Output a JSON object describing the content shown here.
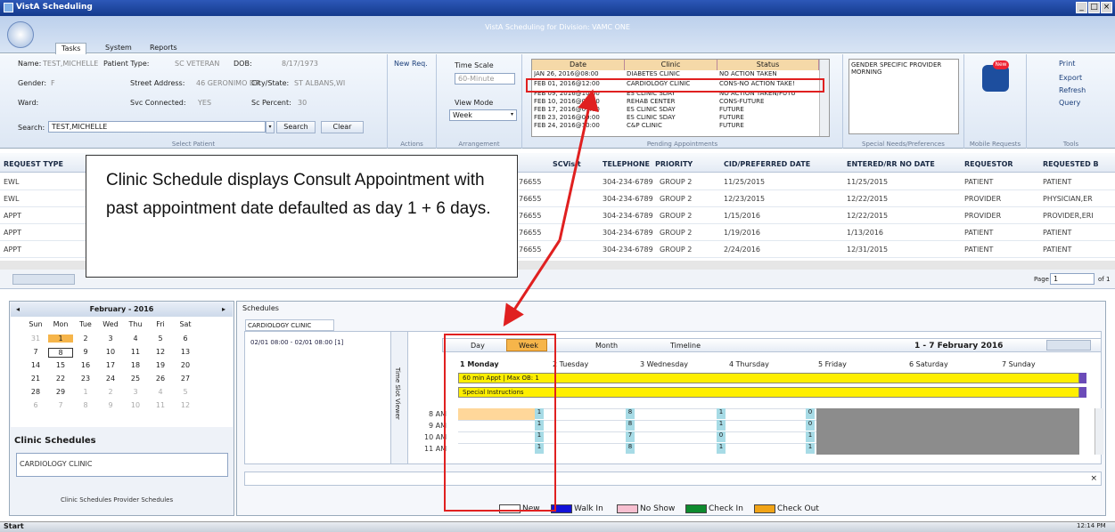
{
  "window": {
    "title": "VistA Scheduling",
    "app_title": "VistA Scheduling for Division: VAMC ONE",
    "controls": [
      "_",
      "□",
      "×"
    ]
  },
  "tabs": [
    "Tasks",
    "System",
    "Reports"
  ],
  "patient": {
    "name_label": "Name:",
    "name": "TEST,MICHELLE",
    "type_label": "Patient Type:",
    "type": "SC VETERAN",
    "dob_label": "DOB:",
    "dob": "8/17/1973",
    "gender_label": "Gender:",
    "gender": "F",
    "street_label": "Street Address:",
    "street": "46 GERONIMO DR",
    "city_label": "City/State:",
    "city": "ST ALBANS,WI",
    "ward_label": "Ward:",
    "svc_label": "Svc Connected:",
    "svc": "YES",
    "scpct_label": "Sc Percent:",
    "scpct": "30",
    "search_label": "Search:",
    "search_value": "TEST,MICHELLE",
    "search_btn": "Search",
    "clear_btn": "Clear",
    "group": "Select Patient"
  },
  "actions": {
    "new_req": "New Req.",
    "group": "Actions"
  },
  "arrangement": {
    "time_scale_label": "Time Scale",
    "time_scale": "60-Minute",
    "view_mode_label": "View Mode",
    "view_mode": "Week",
    "group": "Arrangement"
  },
  "pending": {
    "headers": [
      "Date",
      "Clinic",
      "Status"
    ],
    "group": "Pending Appointments",
    "rows": [
      [
        "JAN 26, 2016@08:00",
        "DIABETES CLINIC",
        "NO ACTION TAKEN"
      ],
      [
        "FEB 01, 2016@12:00",
        "CARDIOLOGY CLINIC",
        "CONS-NO ACTION TAKE!"
      ],
      [
        "FEB 09, 2016@10:00",
        "ES CLINIC SDAY",
        "NO ACTION TAKEN/FUTU"
      ],
      [
        "FEB 10, 2016@09:00",
        "REHAB CENTER",
        "CONS-FUTURE"
      ],
      [
        "FEB 17, 2016@09:00",
        "ES CLINIC SDAY",
        "FUTURE"
      ],
      [
        "FEB 23, 2016@09:00",
        "ES CLINIC SDAY",
        "FUTURE"
      ],
      [
        "FEB 24, 2016@10:00",
        "C&P CLINIC",
        "FUTURE"
      ]
    ]
  },
  "special": {
    "text": "GENDER SPECIFIC PROVIDER MORNING",
    "group": "Special Needs/Preferences"
  },
  "mobile": {
    "badge": "New",
    "group": "Mobile Requests"
  },
  "tools": {
    "items": [
      "Print",
      "Export",
      "Refresh",
      "Query"
    ],
    "group": "Tools"
  },
  "grid": {
    "headers": [
      "REQUEST TYPE",
      "SCVisit",
      "TELEPHONE",
      "PRIORITY",
      "CID/PREFERRED DATE",
      "ENTERED/RR NO DATE",
      "REQUESTOR",
      "REQUESTED B"
    ],
    "rows": [
      [
        "EWL",
        "76655",
        "304-234-6789",
        "GROUP 2",
        "11/25/2015",
        "11/25/2015",
        "PATIENT",
        "PATIENT"
      ],
      [
        "EWL",
        "76655",
        "304-234-6789",
        "GROUP 2",
        "12/23/2015",
        "12/22/2015",
        "PROVIDER",
        "PHYSICIAN,ER"
      ],
      [
        "APPT",
        "76655",
        "304-234-6789",
        "GROUP 2",
        "1/15/2016",
        "12/22/2015",
        "PROVIDER",
        "PROVIDER,ERI"
      ],
      [
        "APPT",
        "76655",
        "304-234-6789",
        "GROUP 2",
        "1/19/2016",
        "1/13/2016",
        "PATIENT",
        "PATIENT"
      ],
      [
        "APPT",
        "76655",
        "304-234-6789",
        "GROUP 2",
        "2/24/2016",
        "12/31/2015",
        "PATIENT",
        "PATIENT"
      ]
    ],
    "page_label": "Page",
    "page": "1",
    "of": "of 1"
  },
  "callout": "Clinic Schedule displays Consult Appointment with past appointment date defaulted as day 1 + 6 days.",
  "calendar": {
    "month": "February - 2016",
    "days": [
      "Sun",
      "Mon",
      "Tue",
      "Wed",
      "Thu",
      "Fri",
      "Sat"
    ],
    "weeks": [
      [
        "31",
        "1",
        "2",
        "3",
        "4",
        "5",
        "6"
      ],
      [
        "7",
        "8",
        "9",
        "10",
        "11",
        "12",
        "13"
      ],
      [
        "14",
        "15",
        "16",
        "17",
        "18",
        "19",
        "20"
      ],
      [
        "21",
        "22",
        "23",
        "24",
        "25",
        "26",
        "27"
      ],
      [
        "28",
        "29",
        "1",
        "2",
        "3",
        "4",
        "5"
      ],
      [
        "6",
        "7",
        "8",
        "9",
        "10",
        "11",
        "12"
      ]
    ]
  },
  "clinic_schedules": {
    "title": "Clinic Schedules",
    "item": "CARDIOLOGY CLINIC",
    "tabs": "Clinic Schedules  Provider Schedules"
  },
  "schedule": {
    "pane_title": "Schedules",
    "clinic_tab": "CARDIOLOGY CLINIC",
    "slot_range": "02/01 08:00 - 02/01 08:00 [1]",
    "timeslot": "Time Slot Viewer",
    "views": [
      "Day",
      "Week",
      "Month",
      "Timeline"
    ],
    "range": "1 - 7 February 2016",
    "days": [
      "1 Monday",
      "2 Tuesday",
      "3 Wednesday",
      "4 Thursday",
      "5 Friday",
      "6 Saturday",
      "7 Sunday"
    ],
    "appt": "60 min Appt | Max OB: 1",
    "special": "Special Instructions",
    "hours": [
      "8 AM",
      "9 AM",
      "10 AM",
      "11 AM"
    ]
  },
  "legend": [
    "New",
    "Walk In",
    "No Show",
    "Check In",
    "Check Out"
  ],
  "taskbar": {
    "start": "Start",
    "time": "12:14 PM"
  }
}
